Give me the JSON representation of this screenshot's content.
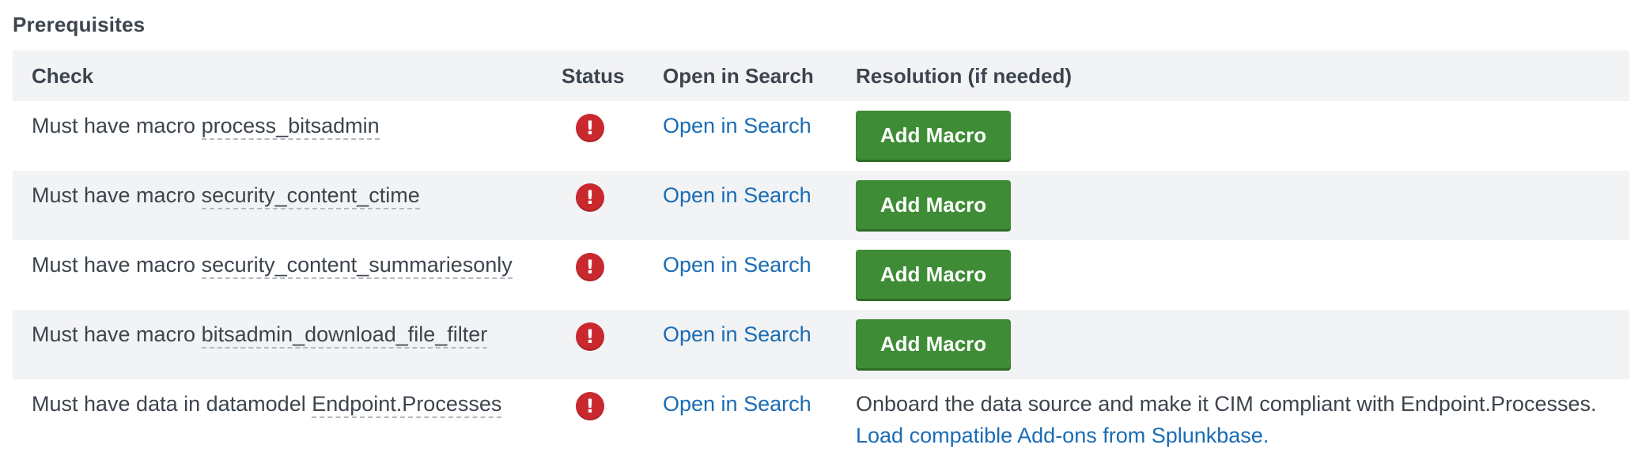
{
  "section_title": "Prerequisites",
  "table": {
    "headers": {
      "check": "Check",
      "status": "Status",
      "open_in_search": "Open in Search",
      "resolution": "Resolution (if needed)"
    },
    "rows": [
      {
        "check_prefix": "Must have macro ",
        "check_name": "process_bitsadmin",
        "status": "error",
        "open_link": "Open in Search",
        "resolution_button": "Add Macro"
      },
      {
        "check_prefix": "Must have macro ",
        "check_name": "security_content_ctime",
        "status": "error",
        "open_link": "Open in Search",
        "resolution_button": "Add Macro"
      },
      {
        "check_prefix": "Must have macro ",
        "check_name": "security_content_summariesonly",
        "status": "error",
        "open_link": "Open in Search",
        "resolution_button": "Add Macro"
      },
      {
        "check_prefix": "Must have macro ",
        "check_name": "bitsadmin_download_file_filter",
        "status": "error",
        "open_link": "Open in Search",
        "resolution_button": "Add Macro"
      },
      {
        "check_prefix": "Must have data in datamodel ",
        "check_name": "Endpoint.Processes",
        "status": "error",
        "open_link": "Open in Search",
        "resolution_text": "Onboard the data source and make it CIM compliant with Endpoint.Processes.",
        "resolution_link": "Load compatible Add-ons from Splunkbase."
      }
    ]
  },
  "status_icon_glyph": "!",
  "colors": {
    "error_red": "#c8282e",
    "button_green": "#3e8c35",
    "link_blue": "#1a6cb5",
    "header_bg": "#f2f3f5",
    "text": "#3c444d"
  }
}
